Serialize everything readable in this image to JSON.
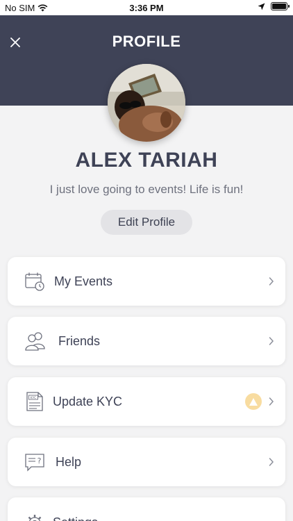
{
  "status_bar": {
    "carrier": "No SIM",
    "time": "3:36 PM"
  },
  "header": {
    "title": "PROFILE"
  },
  "profile": {
    "name": "ALEX TARIAH",
    "bio": "I just love going to events! Life is fun!",
    "edit_label": "Edit Profile"
  },
  "menu": {
    "items": [
      {
        "label": "My Events",
        "icon": "calendar-clock-icon"
      },
      {
        "label": "Friends",
        "icon": "friends-icon"
      },
      {
        "label": "Update KYC",
        "icon": "kyc-document-icon",
        "badge": "warning-icon"
      },
      {
        "label": "Help",
        "icon": "help-chat-icon"
      },
      {
        "label": "Settings",
        "icon": "gear-icon"
      }
    ]
  },
  "colors": {
    "header_bg": "#3f4357",
    "title_text": "#3e4256",
    "warning_badge": "#f8dca0",
    "warning_icon": "#ffffff"
  }
}
